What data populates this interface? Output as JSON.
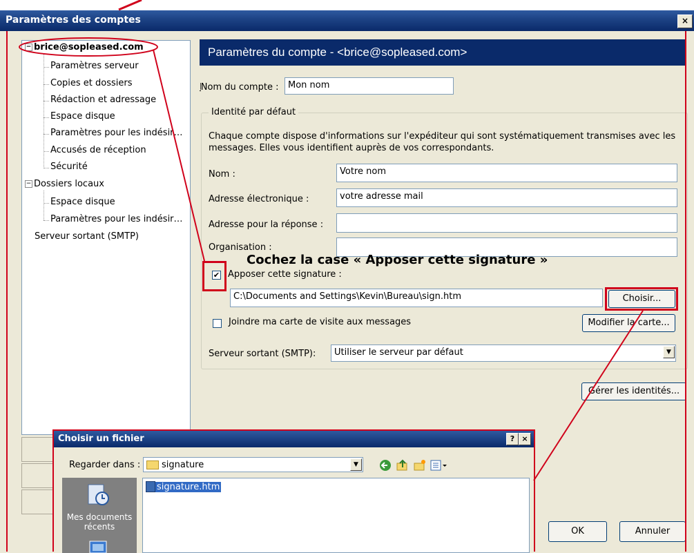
{
  "window": {
    "title": "Paramètres des comptes",
    "close_glyph": "×"
  },
  "tree": {
    "account": "brice@sopleased.com",
    "account_items": [
      "Paramètres serveur",
      "Copies et dossiers",
      "Rédaction et adressage",
      "Espace disque",
      "Paramètres pour les indésir…",
      "Accusés de réception",
      "Sécurité"
    ],
    "local": "Dossiers locaux",
    "local_items": [
      "Espace disque",
      "Paramètres pour les indésir…"
    ],
    "smtp": "Serveur sortant (SMTP)"
  },
  "panel": {
    "header": "Paramètres du compte - <brice@sopleased.com>",
    "account_name_label": "Nom du compte :",
    "account_name_value": "Mon nom",
    "identity_legend": "Identité par défaut",
    "identity_desc": "Chaque compte dispose d'informations sur l'expéditeur qui sont systématiquement transmises avec les messages. Elles vous identifient auprès de vos correspondants.",
    "name_label": "Nom :",
    "name_value": "Votre nom",
    "email_label": "Adresse électronique :",
    "email_value": "votre adresse mail",
    "reply_label": "Adresse pour la réponse :",
    "reply_value": "",
    "org_label": "Organisation :",
    "org_value": "",
    "signature_label": "Apposer cette signature :",
    "signature_checked": true,
    "signature_path": "C:\\Documents and Settings\\Kevin\\Bureau\\sign.htm",
    "choose_button": "Choisir...",
    "vcard_label": "Joindre ma carte de visite aux messages",
    "vcard_checked": false,
    "edit_card_button": "Modifier la carte...",
    "smtp_label": "Serveur sortant (SMTP):",
    "smtp_value": "Utiliser le serveur par défaut",
    "manage_identities_button": "Gérer les identités...",
    "ok_button": "OK",
    "cancel_button": "Annuler"
  },
  "annotation": {
    "callout": "Cochez la case « Apposer cette signature »",
    "color": "#d0021b"
  },
  "file_dialog": {
    "title": "Choisir un fichier",
    "help_glyph": "?",
    "close_glyph": "×",
    "look_in_label": "Regarder dans :",
    "look_in_value": "signature",
    "places": [
      "Mes documents récents"
    ],
    "files": [
      "signature.htm"
    ]
  },
  "colors": {
    "accent": "#0a2a6a",
    "selection": "#316ac5"
  }
}
